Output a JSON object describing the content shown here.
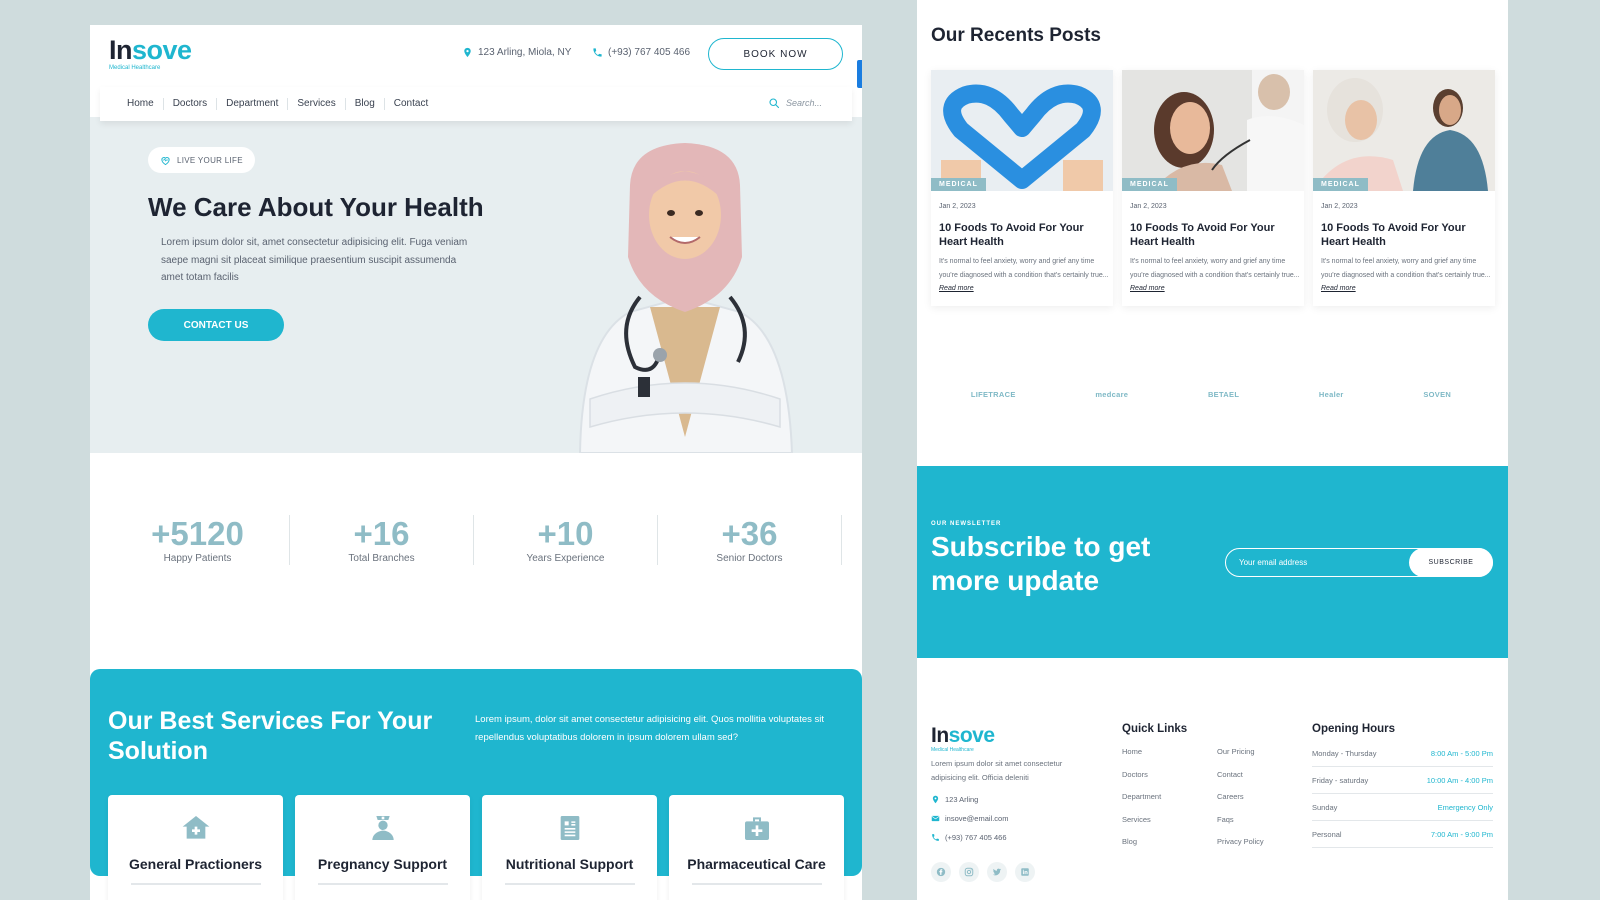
{
  "header": {
    "logo_main_a": "In",
    "logo_main_b": "sove",
    "logo_sub": "Medical Healthcare",
    "address": "123 Arling, Miola, NY",
    "phone": "(+93) 767 405 466",
    "book_label": "BOOK NOW"
  },
  "nav": {
    "items": [
      "Home",
      "Doctors",
      "Department",
      "Services",
      "Blog",
      "Contact"
    ],
    "search_placeholder": "Search..."
  },
  "hero": {
    "badge": "LIVE YOUR LIFE",
    "title": "We Care About Your Health",
    "text": "Lorem ipsum dolor sit, amet consectetur adipisicing elit. Fuga veniam saepe magni sit placeat similique praesentium suscipit assumenda amet totam facilis",
    "cta": "CONTACT US"
  },
  "stats": [
    {
      "num": "+5120",
      "label": "Happy Patients"
    },
    {
      "num": "+16",
      "label": "Total Branches"
    },
    {
      "num": "+10",
      "label": "Years Experience"
    },
    {
      "num": "+36",
      "label": "Senior Doctors"
    }
  ],
  "services": {
    "title": "Our Best Services For Your Solution",
    "text": "Lorem ipsum, dolor sit amet consectetur adipisicing elit. Quos mollitia voluptates sit repellendus voluptatibus dolorem in ipsum dolorem ullam sed?",
    "cards": [
      {
        "name": "General Practioners",
        "icon": "house-medical-icon"
      },
      {
        "name": "Pregnancy Support",
        "icon": "nurse-icon"
      },
      {
        "name": "Nutritional Support",
        "icon": "document-icon"
      },
      {
        "name": "Pharmaceutical Care",
        "icon": "medical-kit-icon"
      }
    ]
  },
  "posts": {
    "title": "Our Recents Posts",
    "items": [
      {
        "tag": "MEDICAL",
        "date": "Jan 2, 2023",
        "title": "10 Foods To Avoid For Your Heart Health",
        "text": "It's normal to feel anxiety, worry and grief any time you're diagnosed with a condition that's certainly true...",
        "read_more": "Read more"
      },
      {
        "tag": "MEDICAL",
        "date": "Jan 2, 2023",
        "title": "10 Foods To Avoid For Your Heart Health",
        "text": "It's normal to feel anxiety, worry and grief any time you're diagnosed with a condition that's certainly true...",
        "read_more": "Read more"
      },
      {
        "tag": "MEDICAL",
        "date": "Jan 2, 2023",
        "title": "10 Foods To Avoid For Your Heart Health",
        "text": "It's normal to feel anxiety, worry and grief any time you're diagnosed with a condition that's certainly true...",
        "read_more": "Read more"
      }
    ]
  },
  "partners": [
    "LIFETRACE",
    "medcare",
    "BETAEL",
    "Healer",
    "SOVEN"
  ],
  "newsletter": {
    "label": "OUR NEWSLETTER",
    "title": "Subscribe to get more update",
    "placeholder": "Your email address",
    "button": "SUBSCRIBE"
  },
  "footer": {
    "desc": "Lorem ipsum dolor sit amet consectetur adipisicing elit. Officia deleniti",
    "address": "123 Arling",
    "email": "insove@email.com",
    "phone": "(+93) 767 405 466",
    "quick_links_title": "Quick Links",
    "links_col1": [
      "Home",
      "Doctors",
      "Department",
      "Services",
      "Blog"
    ],
    "links_col2": [
      "Our Pricing",
      "Contact",
      "Careers",
      "Faqs",
      "Privacy Policy"
    ],
    "hours_title": "Opening Hours",
    "hours": [
      {
        "day": "Monday - Thursday",
        "time": "8:00 Am - 5:00 Pm"
      },
      {
        "day": "Friday - saturday",
        "time": "10:00 Am - 4:00 Pm"
      },
      {
        "day": "Sunday",
        "time": "Emergency Only"
      },
      {
        "day": "Personal",
        "time": "7:00 Am - 9:00 Pm"
      }
    ],
    "socials": [
      "facebook-icon",
      "instagram-icon",
      "twitter-icon",
      "linkedin-icon"
    ]
  },
  "colors": {
    "accent": "#1fb6cf",
    "dark": "#1e2432",
    "muted": "#8fbcc6",
    "hero_bg": "#e7eef0"
  }
}
